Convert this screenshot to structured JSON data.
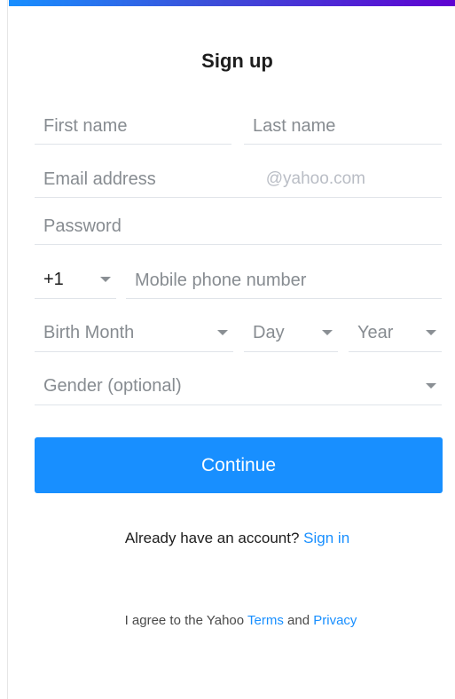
{
  "form": {
    "title": "Sign up",
    "first_name_placeholder": "First name",
    "last_name_placeholder": "Last name",
    "email_placeholder": "Email address",
    "email_suffix": "@yahoo.com",
    "password_placeholder": "Password",
    "country_code": "+1",
    "phone_placeholder": "Mobile phone number",
    "birth_month": "Birth Month",
    "birth_day": "Day",
    "birth_year": "Year",
    "gender": "Gender (optional)",
    "continue_label": "Continue"
  },
  "signin": {
    "prompt": "Already have an account?",
    "link": "Sign in"
  },
  "legal": {
    "prefix": "I agree to the Yahoo",
    "terms": "Terms",
    "and": "and",
    "privacy": "Privacy"
  },
  "colors": {
    "accent": "#188fff",
    "brand_purple": "#5f01d1"
  }
}
